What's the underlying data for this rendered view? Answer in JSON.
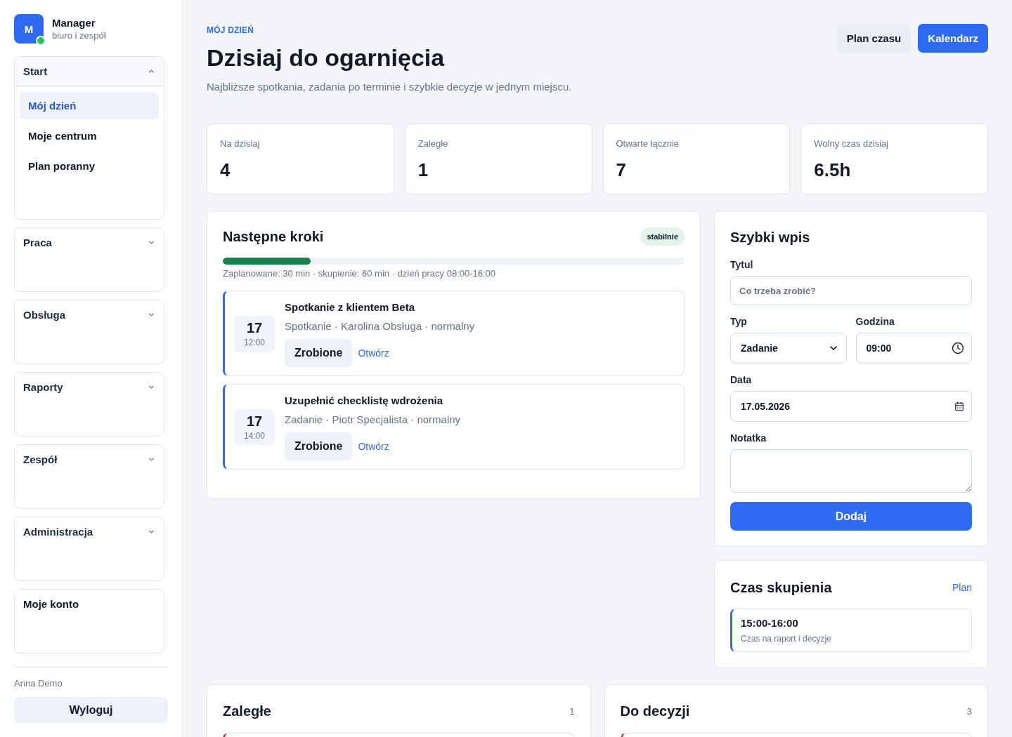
{
  "sidebar": {
    "brand": {
      "logo_letter": "M",
      "online": true,
      "name": "Manager",
      "subtitle": "biuro i zespół"
    },
    "groups": [
      {
        "kind": "group",
        "label": "Start",
        "expanded": true,
        "items": [
          {
            "label": "Mój dzień",
            "selected": true
          },
          {
            "label": "Moje centrum",
            "selected": false
          },
          {
            "label": "Plan poranny",
            "selected": false
          }
        ]
      },
      {
        "kind": "group",
        "label": "Praca",
        "expanded": false
      },
      {
        "kind": "group",
        "label": "Obsługa",
        "expanded": false
      },
      {
        "kind": "group",
        "label": "Raporty",
        "expanded": false
      },
      {
        "kind": "group",
        "label": "Zespół",
        "expanded": false
      },
      {
        "kind": "group",
        "label": "Administracja",
        "expanded": false
      },
      {
        "kind": "link",
        "label": "Moje konto"
      }
    ],
    "user_name": "Anna Demo",
    "logout_button": "Wyloguj"
  },
  "header": {
    "eyebrow": "MÓJ DZIEŃ",
    "title": "Dzisiaj do ogarnięcia",
    "subtitle": "Najbliższe spotkania, zadania po terminie i szybkie decyzje w jednym miejscu.",
    "buttons": [
      {
        "kind": "secondary",
        "label": "Plan czasu"
      },
      {
        "kind": "primary",
        "label": "Kalendarz"
      }
    ]
  },
  "stats": [
    {
      "label": "Na dzisiaj",
      "value": "4"
    },
    {
      "label": "Zaległe",
      "value": "1"
    },
    {
      "label": "Otwarte łącznie",
      "value": "7"
    },
    {
      "label": "Wolny czas dzisiaj",
      "value": "6.5h"
    }
  ],
  "next_steps": {
    "title": "Następne kroki",
    "status_badge": "stabilnie",
    "progress": {
      "level": 0.19
    },
    "summary": "Zaplanowane: 30 min · skupienie: 60 min · dzień pracy 08:00-16:00",
    "items": [
      {
        "day": "17",
        "time": "12:00",
        "title": "Spotkanie z klientem Beta",
        "meta": "Spotkanie · Karolina Obsługa · normalny",
        "done_button": "Zrobione",
        "open_link": "Otwórz"
      },
      {
        "day": "17",
        "time": "14:00",
        "title": "Uzupełnić checklistę wdrożenia",
        "meta": "Zadanie · Piotr Specjalista · normalny",
        "done_button": "Zrobione",
        "open_link": "Otwórz"
      }
    ]
  },
  "quick_entry": {
    "title": "Szybki wpis",
    "fields": [
      {
        "kind": "text",
        "label": "Tytul",
        "placeholder": "Co trzeba zrobić?"
      },
      {
        "kind": "select",
        "label": "Typ",
        "value": "Zadanie"
      },
      {
        "kind": "time",
        "label": "Godzina",
        "value": "09:00"
      },
      {
        "kind": "date",
        "label": "Data",
        "value": "17.05.2026"
      },
      {
        "kind": "textarea",
        "label": "Notatka"
      }
    ],
    "submit_button": "Dodaj"
  },
  "focus_time": {
    "title": "Czas skupienia",
    "link": "Plan",
    "blocks": [
      {
        "time": "15:00-16:00",
        "description": "Czas na raport i decyzje"
      }
    ]
  },
  "bottom_sections": [
    {
      "title": "Zaległe",
      "count": "1"
    },
    {
      "title": "Do decyzji",
      "count": "3"
    }
  ]
}
